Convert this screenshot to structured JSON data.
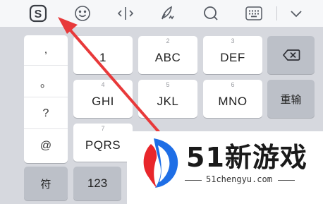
{
  "toolbar": {
    "icons": [
      "sogou-logo-icon",
      "emoji-icon",
      "cursor-move-icon",
      "handwriting-icon",
      "search-icon",
      "keyboard-icon",
      "chevron-down-icon"
    ],
    "logo_letter": "S"
  },
  "punctuation": {
    "items": [
      ",",
      "。",
      "?",
      "@"
    ]
  },
  "keys": {
    "row1": [
      {
        "digit": "",
        "label": "1"
      },
      {
        "digit": "2",
        "label": "ABC"
      },
      {
        "digit": "3",
        "label": "DEF"
      }
    ],
    "row2": [
      {
        "digit": "4",
        "label": "GHI"
      },
      {
        "digit": "5",
        "label": "JKL"
      },
      {
        "digit": "6",
        "label": "MNO"
      }
    ],
    "row3": [
      {
        "digit": "7",
        "label": "PQRS"
      }
    ],
    "reinput_label": "重输",
    "symbol_label": "符",
    "number_label": "123"
  },
  "watermark": {
    "title": "51新游戏",
    "domain": "51chengyu.com"
  },
  "colors": {
    "arrow": "#e8393a",
    "logo_blue": "#1e6ee6",
    "logo_red": "#e8262b"
  }
}
